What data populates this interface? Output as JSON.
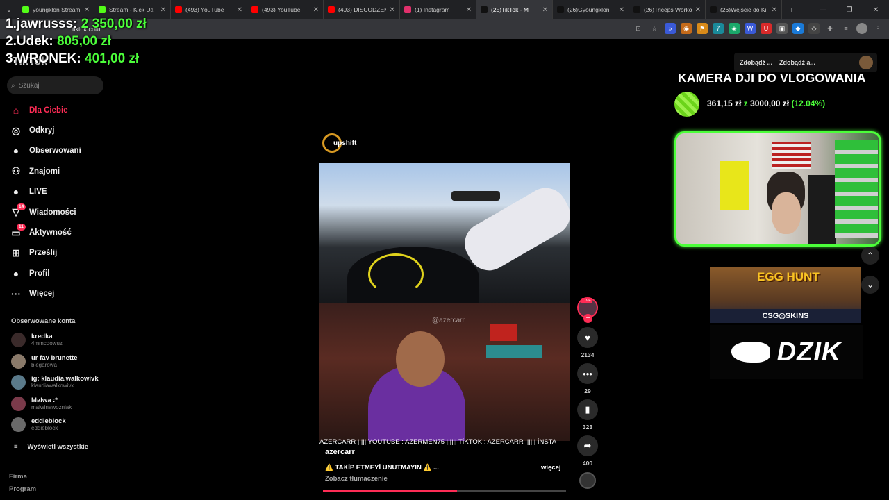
{
  "browser": {
    "tabs": [
      {
        "title": "youngklon Stream",
        "color": "#53fc18"
      },
      {
        "title": "Stream - Kick Da",
        "color": "#53fc18"
      },
      {
        "title": "(493) YouTube",
        "color": "#ff0000"
      },
      {
        "title": "(493) YouTube",
        "color": "#ff0000"
      },
      {
        "title": "(493) DISCODZEM",
        "color": "#ff0000"
      },
      {
        "title": "(1) Instagram",
        "color": "#e1306c"
      },
      {
        "title": "(25)TikTok - M",
        "color": "#111111",
        "active": true
      },
      {
        "title": "(26)Gyoungklon",
        "color": "#111111"
      },
      {
        "title": "(26)Triceps Worko",
        "color": "#111111"
      },
      {
        "title": "(26)Wejście do Ki",
        "color": "#111111"
      }
    ],
    "url": "tiktok.com"
  },
  "leaderboard": [
    {
      "rank": "1.",
      "name": "jawrusss:",
      "amount": "2 350,00 zł"
    },
    {
      "rank": "2.",
      "name": "Udek:",
      "amount": "805,00 zł"
    },
    {
      "rank": "3.",
      "name": "WRONEK:",
      "amount": "401,00 zł"
    }
  ],
  "tiktok": {
    "logo": "TikTok",
    "search_placeholder": "Szukaj",
    "nav": [
      {
        "label": "Dla Ciebie",
        "icon": "home-icon",
        "glyph": "⌂",
        "active": true
      },
      {
        "label": "Odkryj",
        "icon": "compass-icon",
        "glyph": "◎"
      },
      {
        "label": "Obserwowani",
        "icon": "following-avatar-icon",
        "glyph": "●"
      },
      {
        "label": "Znajomi",
        "icon": "friends-icon",
        "glyph": "⚇"
      },
      {
        "label": "LIVE",
        "icon": "live-icon",
        "glyph": "●"
      },
      {
        "label": "Wiadomości",
        "icon": "messages-icon",
        "glyph": "▽",
        "badge": "14"
      },
      {
        "label": "Aktywność",
        "icon": "activity-icon",
        "glyph": "▭",
        "badge": "11"
      },
      {
        "label": "Prześlij",
        "icon": "upload-icon",
        "glyph": "⊞"
      },
      {
        "label": "Profil",
        "icon": "profile-icon",
        "glyph": "●"
      },
      {
        "label": "Więcej",
        "icon": "more-icon",
        "glyph": "···"
      }
    ],
    "followed_heading": "Obserwowane konta",
    "followed": [
      {
        "name": "kredka",
        "user": "4mmcdowuz",
        "color": "#3a2a2a"
      },
      {
        "name": "ur fav brunette",
        "user": "biegarowa",
        "color": "#8a7a6a"
      },
      {
        "name": "ig: klaudia.walkowivk",
        "user": "klaudiawalkowivk",
        "color": "#5a7a8a"
      },
      {
        "name": "Malwa :*",
        "user": "malwinawozniak",
        "color": "#7a3a4a"
      },
      {
        "name": "eddieblock",
        "user": "eddieblock_",
        "color": "#6a6a6a"
      }
    ],
    "show_all": "Wyświetl wszystkie",
    "footer": [
      "Firma",
      "Program"
    ]
  },
  "video": {
    "sponsor": "upshift",
    "watermark": "@azercarr",
    "marquee": "AZERCARR ||||||YOUTUBE : AZERMEN75 |||||| TİKTOK : AZERCARR |||||| İNSTA",
    "author": "azercarr",
    "caption": "⚠️ TAKİP ETMEYİ UNUTMAYIN ⚠️ ...",
    "more": "więcej",
    "translate": "Zobacz tłumaczenie",
    "progress": 0.55,
    "live_tag": "LIVE",
    "likes": "2134",
    "comments": "29",
    "saves": "323",
    "shares": "400"
  },
  "overlay": {
    "btn1": "Zdobądź ...",
    "btn2": "Zdobądź a...",
    "goal_title": "KAMERA DJI DO VLOGOWANIA",
    "goal_current": "361,15 zł",
    "goal_z": "z",
    "goal_target": "3000,00 zł",
    "goal_pct": "(12.04%)",
    "egg_title": "EGG HUNT",
    "egg_brand": "CSG◎SKINS",
    "dzik": "DZIK"
  }
}
